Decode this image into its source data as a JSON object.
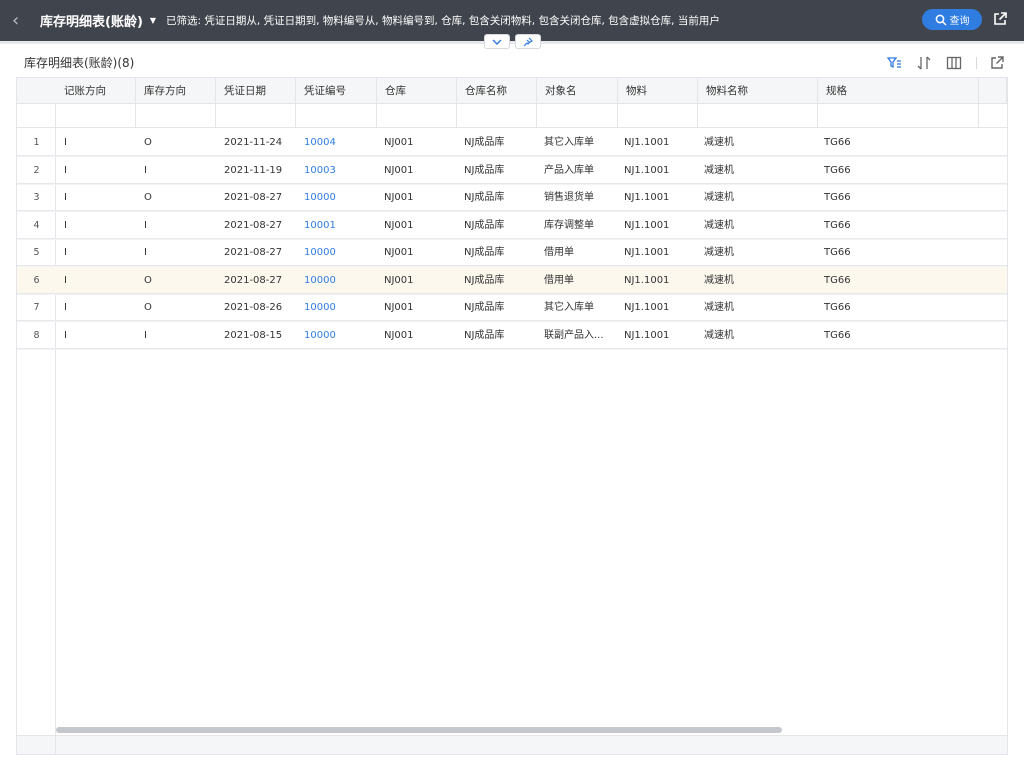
{
  "header": {
    "title": "库存明细表(账龄)",
    "filter_text": "已筛选: 凭证日期从, 凭证日期到, 物料编号从, 物料编号到, 仓库, 包含关闭物料, 包含关闭仓库, 包含虚拟仓库, 当前用户",
    "query_label": "查询",
    "icons": {
      "back": "chevron-left-icon",
      "dropdown": "caret-down-icon",
      "query": "search-icon",
      "export": "export-icon",
      "collapse": "chevron-down-icon",
      "pin": "pin-icon"
    }
  },
  "table": {
    "title": "库存明细表(账龄)(8)",
    "tool_icons": [
      "filter-settings-icon",
      "sort-icon",
      "columns-icon",
      "export-icon"
    ],
    "columns": [
      "记账方向",
      "库存方向",
      "凭证日期",
      "凭证编号",
      "仓库",
      "仓库名称",
      "对象名",
      "物料",
      "物料名称",
      "规格"
    ],
    "rows": [
      {
        "idx": "1",
        "c": [
          "I",
          "O",
          "2021-11-24",
          "10004",
          "NJ001",
          "NJ成品库",
          "其它入库单",
          "NJ1.1001",
          "减速机",
          "TG66"
        ]
      },
      {
        "idx": "2",
        "c": [
          "I",
          "I",
          "2021-11-19",
          "10003",
          "NJ001",
          "NJ成品库",
          "产品入库单",
          "NJ1.1001",
          "减速机",
          "TG66"
        ]
      },
      {
        "idx": "3",
        "c": [
          "I",
          "O",
          "2021-08-27",
          "10000",
          "NJ001",
          "NJ成品库",
          "销售退货单",
          "NJ1.1001",
          "减速机",
          "TG66"
        ]
      },
      {
        "idx": "4",
        "c": [
          "I",
          "I",
          "2021-08-27",
          "10001",
          "NJ001",
          "NJ成品库",
          "库存调整单",
          "NJ1.1001",
          "减速机",
          "TG66"
        ]
      },
      {
        "idx": "5",
        "c": [
          "I",
          "I",
          "2021-08-27",
          "10000",
          "NJ001",
          "NJ成品库",
          "借用单",
          "NJ1.1001",
          "减速机",
          "TG66"
        ]
      },
      {
        "idx": "6",
        "c": [
          "I",
          "O",
          "2021-08-27",
          "10000",
          "NJ001",
          "NJ成品库",
          "借用单",
          "NJ1.1001",
          "减速机",
          "TG66"
        ]
      },
      {
        "idx": "7",
        "c": [
          "I",
          "O",
          "2021-08-26",
          "10000",
          "NJ001",
          "NJ成品库",
          "其它入库单",
          "NJ1.1001",
          "减速机",
          "TG66"
        ]
      },
      {
        "idx": "8",
        "c": [
          "I",
          "I",
          "2021-08-15",
          "10000",
          "NJ001",
          "NJ成品库",
          "联副产品入...",
          "NJ1.1001",
          "减速机",
          "TG66"
        ]
      }
    ],
    "highlighted_row": "6",
    "colors": {
      "topbar": "#40454d",
      "accent": "#2f7de1",
      "highlight_row": "#fdf8ee"
    }
  }
}
